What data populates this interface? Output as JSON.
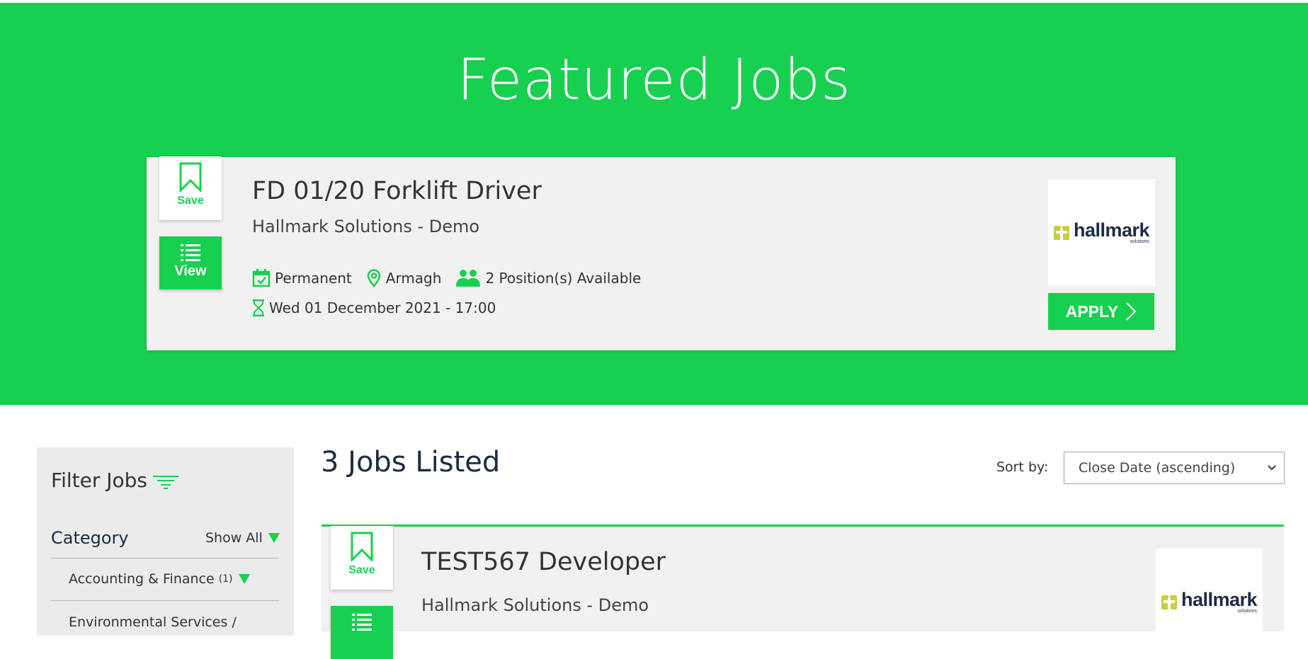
{
  "hero": {
    "title": "Featured Jobs"
  },
  "featured_job": {
    "save_label": "Save",
    "view_label": "View",
    "title": "FD 01/20 Forklift Driver",
    "company": "Hallmark Solutions - Demo",
    "contract_type": "Permanent",
    "location": "Armagh",
    "positions": "2 Position(s) Available",
    "closing": "Wed 01 December 2021 - 17:00",
    "logo_text": "hallmark",
    "logo_sub": "solutions",
    "apply_label": "APPLY"
  },
  "filter": {
    "title": "Filter Jobs",
    "category_label": "Category",
    "show_all_label": "Show All",
    "categories": [
      {
        "label": "Accounting & Finance",
        "count": "(1)"
      },
      {
        "label": "Environmental Services /",
        "count": ""
      }
    ]
  },
  "listing": {
    "count_label": "3 Jobs Listed",
    "sort_label": "Sort by:",
    "sort_value": "Close Date (ascending)"
  },
  "list_jobs": [
    {
      "save_label": "Save",
      "title": "TEST567 Developer",
      "company": "Hallmark Solutions - Demo",
      "logo_text": "hallmark",
      "logo_sub": "solutions"
    }
  ],
  "colors": {
    "accent": "#18d050",
    "navy": "#1d2b44",
    "card_bg": "#f1f1f1",
    "logo_mark": "#c8cf3a"
  }
}
